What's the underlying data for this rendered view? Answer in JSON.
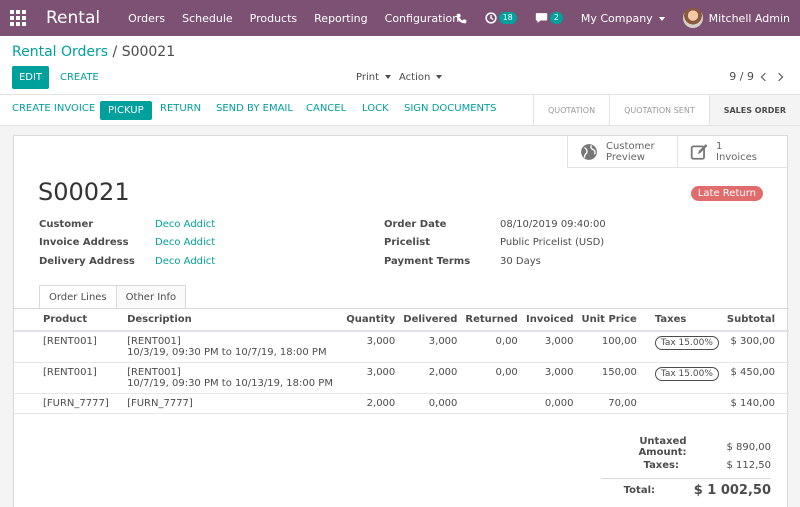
{
  "topbar": {
    "app_name": "Rental",
    "menu": [
      "Orders",
      "Schedule",
      "Products",
      "Reporting",
      "Configuration"
    ],
    "activity_count": "18",
    "message_count": "2",
    "company": "My Company",
    "user": "Mitchell Admin",
    "bg_color": "#7c5173"
  },
  "breadcrumb": {
    "parent": "Rental Orders",
    "separator": "/",
    "current": "S00021"
  },
  "toolbar": {
    "edit": "EDIT",
    "create": "CREATE",
    "print": "Print",
    "action": "Action",
    "pager": "9 / 9"
  },
  "statusbar": {
    "buttons": [
      "CREATE INVOICE",
      "PICKUP",
      "RETURN",
      "SEND BY EMAIL",
      "CANCEL",
      "LOCK",
      "SIGN DOCUMENTS"
    ],
    "stages": [
      "QUOTATION",
      "QUOTATION SENT",
      "SALES ORDER"
    ],
    "active_stage": "SALES ORDER"
  },
  "smart_buttons": {
    "preview_line1": "Customer",
    "preview_line2": "Preview",
    "invoices_count": "1",
    "invoices_label": "Invoices"
  },
  "order": {
    "name": "S00021",
    "status_badge": "Late Return",
    "left_fields": [
      {
        "label": "Customer",
        "value": "Deco Addict"
      },
      {
        "label": "Invoice Address",
        "value": "Deco Addict"
      },
      {
        "label": "Delivery Address",
        "value": "Deco Addict"
      }
    ],
    "right_fields": [
      {
        "label": "Order Date",
        "value": "08/10/2019 09:40:00"
      },
      {
        "label": "Pricelist",
        "value": "Public Pricelist (USD)"
      },
      {
        "label": "Payment Terms",
        "value": "30 Days"
      }
    ]
  },
  "tabs": [
    "Order Lines",
    "Other Info"
  ],
  "lines": {
    "headers": [
      "Product",
      "Description",
      "Quantity",
      "Delivered",
      "Returned",
      "Invoiced",
      "Unit Price",
      "Taxes",
      "Subtotal"
    ],
    "rows": [
      {
        "product": "[RENT001]",
        "desc1": "[RENT001]",
        "desc2": "10/3/19, 09:30 PM to 10/7/19, 18:00 PM",
        "qty": "3,000",
        "delivered": "3,000",
        "returned": "0,00",
        "invoiced": "3,000",
        "price": "100,00",
        "tax": "Tax 15.00%",
        "subtotal": "$ 300,00"
      },
      {
        "product": "[RENT001]",
        "desc1": "[RENT001]",
        "desc2": "10/7/19, 09:30 PM to 10/13/19, 18:00 PM",
        "qty": "3,000",
        "delivered": "2,000",
        "returned": "0,00",
        "invoiced": "3,000",
        "price": "150,00",
        "tax": "Tax 15.00%",
        "subtotal": "$ 450,00"
      },
      {
        "product": "[FURN_7777]",
        "desc1": "[FURN_7777]",
        "desc2": "",
        "qty": "2,000",
        "delivered": "0,000",
        "returned": "",
        "invoiced": "0,000",
        "price": "70,00",
        "tax": "",
        "subtotal": "$ 140,00"
      }
    ]
  },
  "totals": {
    "untaxed_label": "Untaxed Amount:",
    "untaxed": "$ 890,00",
    "taxes_label": "Taxes:",
    "taxes": "$ 112,50",
    "total_label": "Total:",
    "total": "$ 1 002,50"
  }
}
